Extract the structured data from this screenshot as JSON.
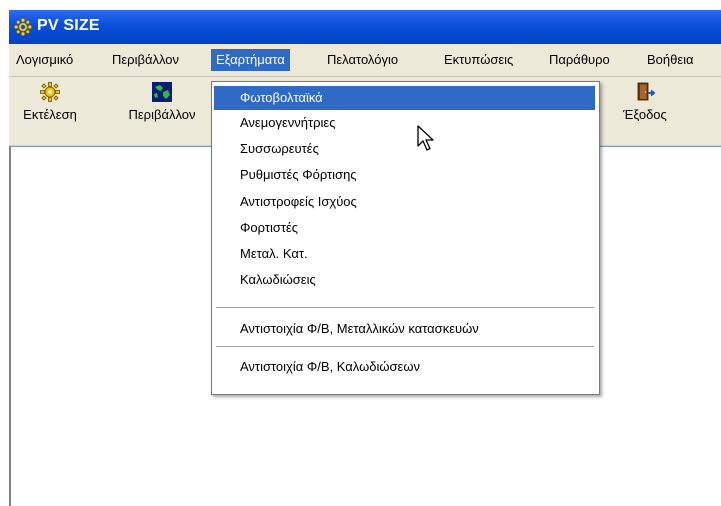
{
  "window": {
    "title": "PV SIZE",
    "app_icon": "sun-icon"
  },
  "menubar": {
    "items": [
      {
        "label": "Λογισμικό"
      },
      {
        "label": "Περιβάλλον"
      },
      {
        "label": "Εξαρτήματα",
        "active": true
      },
      {
        "label": "Πελατολόγιο"
      },
      {
        "label": "Εκτυπώσεις"
      },
      {
        "label": "Παράθυρο"
      },
      {
        "label": "Βοήθεια"
      }
    ]
  },
  "toolbar": {
    "buttons": [
      {
        "label": "Εκτέλεση",
        "icon": "sun-gear-icon"
      },
      {
        "label": "Περιβάλλον",
        "icon": "globe-icon"
      },
      {
        "label": "Έξοδος",
        "icon": "exit-door-icon"
      }
    ]
  },
  "dropdown": {
    "parent": "Εξαρτήματα",
    "groups": [
      [
        {
          "label": "Φωτοβολταϊκά",
          "highlighted": true
        },
        {
          "label": "Ανεμογεννήτριες"
        },
        {
          "label": "Συσσωρευτές"
        },
        {
          "label": "Ρυθμιστές Φόρτισης"
        },
        {
          "label": "Αντιστροφείς Ισχύος"
        },
        {
          "label": "Φορτιστές"
        },
        {
          "label": "Μεταλ. Κατ."
        },
        {
          "label": "Καλωδιώσεις"
        }
      ],
      [
        {
          "label": "Αντιστοιχία Φ/Β, Μεταλλικών κατασκευών"
        }
      ],
      [
        {
          "label": "Αντιστοιχία Φ/Β, Καλωδιώσεων"
        }
      ]
    ]
  },
  "colors": {
    "titlebar": "#0a4fd8",
    "menu_highlight": "#316ac5",
    "menubar_bg": "#ece9d8",
    "client_bg": "#ffffff"
  },
  "cursor": "arrow-pointer-icon"
}
